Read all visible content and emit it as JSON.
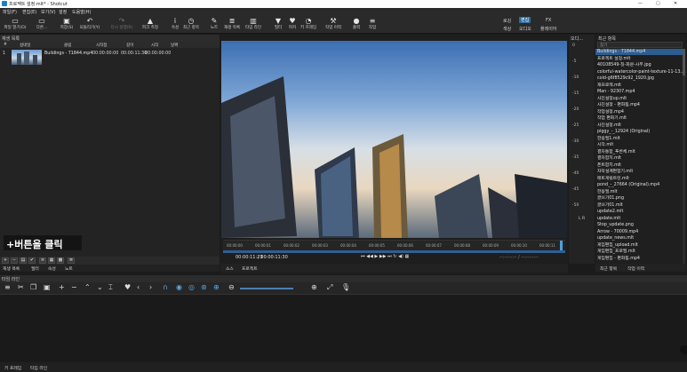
{
  "window": {
    "title": "프로젝트 설정.mlt* - Shotcut",
    "min": "—",
    "max": "▢",
    "close": "✕"
  },
  "menu": [
    "파일(F)",
    "편집(E)",
    "보기(V)",
    "설정",
    "도움말(H)"
  ],
  "toolbar": [
    {
      "icon": "folder-icon",
      "glyph": "▭",
      "label": "파일 열기(O)"
    },
    {
      "icon": "monitor-icon",
      "glyph": "▭",
      "label": "다른..."
    },
    {
      "icon": "save-icon",
      "glyph": "▣",
      "label": "저장(S)"
    },
    {
      "icon": "undo-icon",
      "glyph": "↶",
      "label": "되돌리기(Y)"
    },
    {
      "icon": "redo-icon",
      "glyph": "↷",
      "label": "다시 실행(R)"
    },
    {
      "icon": "peak-meter-icon",
      "glyph": "▲",
      "label": "피크 측정"
    },
    {
      "icon": "info-icon",
      "glyph": "i",
      "label": "속성"
    },
    {
      "icon": "clock-icon",
      "glyph": "◷",
      "label": "최근 항목"
    },
    {
      "icon": "notes-icon",
      "glyph": "✎",
      "label": "노트"
    },
    {
      "icon": "playlist-icon",
      "glyph": "≣",
      "label": "재생 목록"
    },
    {
      "icon": "timeline-icon",
      "glyph": "▥",
      "label": "타임 라인"
    },
    {
      "icon": "filter-icon",
      "glyph": "▼",
      "label": "필터"
    },
    {
      "icon": "marker-icon",
      "glyph": "♥",
      "label": "마커"
    },
    {
      "icon": "keyframe-icon",
      "glyph": "◔",
      "label": "키 프레임"
    },
    {
      "icon": "history-icon",
      "glyph": "⚒",
      "label": "작업 이력"
    },
    {
      "icon": "export-icon",
      "glyph": "●",
      "label": "출력"
    },
    {
      "icon": "jobs-icon",
      "glyph": "≡",
      "label": "작업"
    }
  ],
  "layouts": {
    "row1": [
      "로깅",
      "편집",
      "FX"
    ],
    "row2": [
      "색상",
      "오디오",
      "플레이어"
    ]
  },
  "playlist": {
    "title": "재생 목록",
    "columns": [
      "#",
      "섬네일",
      "클립",
      "시작점",
      "길이",
      "시작",
      "날짜"
    ],
    "rows": [
      {
        "num": "1",
        "clip": "Buildings - 71844.mp4",
        "in": "00:00:00:00",
        "duration": "00:00:11:30",
        "start": "00:00:00:00"
      }
    ],
    "overlay": "+버튼을 클릭",
    "tabs": [
      "재생 목록",
      "필터",
      "속성",
      "노트"
    ]
  },
  "player": {
    "timecode_current": "00:00:11:23",
    "timecode_total": "/ 00:00:11:30",
    "ruler": [
      "00:00:00",
      "00:00:01",
      "00:00:02",
      "00:00:03",
      "00:00:04",
      "00:00:05",
      "00:00:06",
      "00:00:07",
      "00:00:08",
      "00:00:09",
      "00:00:10",
      "00:00:11"
    ],
    "in_out": "--:--:--:-- / --:--:--:--",
    "tabs": [
      "소스",
      "프로젝트"
    ]
  },
  "meter": {
    "title": "오디...",
    "scale": [
      "0",
      "-5",
      "-10",
      "-15",
      "-20",
      "-25",
      "-30",
      "-35",
      "-40",
      "-45",
      "-50"
    ],
    "lr": "L R"
  },
  "recent": {
    "title": "최근 항목",
    "search_placeholder": "찾기",
    "items": [
      "Buildings - 71844.mp4",
      "프로젝트 설정.mlt",
      "40108549-칠-화문-사무.jpg",
      "colorful-watercolor-paint-texture-11-13...",
      "cold-g6f8529c92_1920.jpg",
      "재프로젝.mlt",
      "Man - 92307.mp4",
      "사진설정up.mlt",
      "사진설정 - 편화됨.mp4",
      "작업설정.mp4",
      "작업 편화기.mlt",
      "사진설정.mlt",
      "piggy_-_12924 (Original)",
      "한용필1.mlt",
      "시작.mlt",
      "결자통합_푸른체.mlt",
      "결자합치.mlt",
      "폰트합치.mlt",
      "자막설계편합기.mlt",
      "매트게릴트런.mlt",
      "pond_-_27664 (Original).mp4",
      "한용필.mlt",
      "글쓰기01.png",
      "글쓰기01.mlt",
      "update2.mlt",
      "update.mlt",
      "Stop_update.png",
      "Arrow - 70009.mp4",
      "update_news.mlt",
      "게임편집_upload.mlt",
      "게임편집_프로필.mlt",
      "게임편집 - 편화됨.mp4"
    ],
    "tabs": [
      "최근 항목",
      "작업 이력"
    ]
  },
  "timeline": {
    "title": "타임 라인",
    "tabs": [
      "키 프레임",
      "타임 라인"
    ]
  }
}
